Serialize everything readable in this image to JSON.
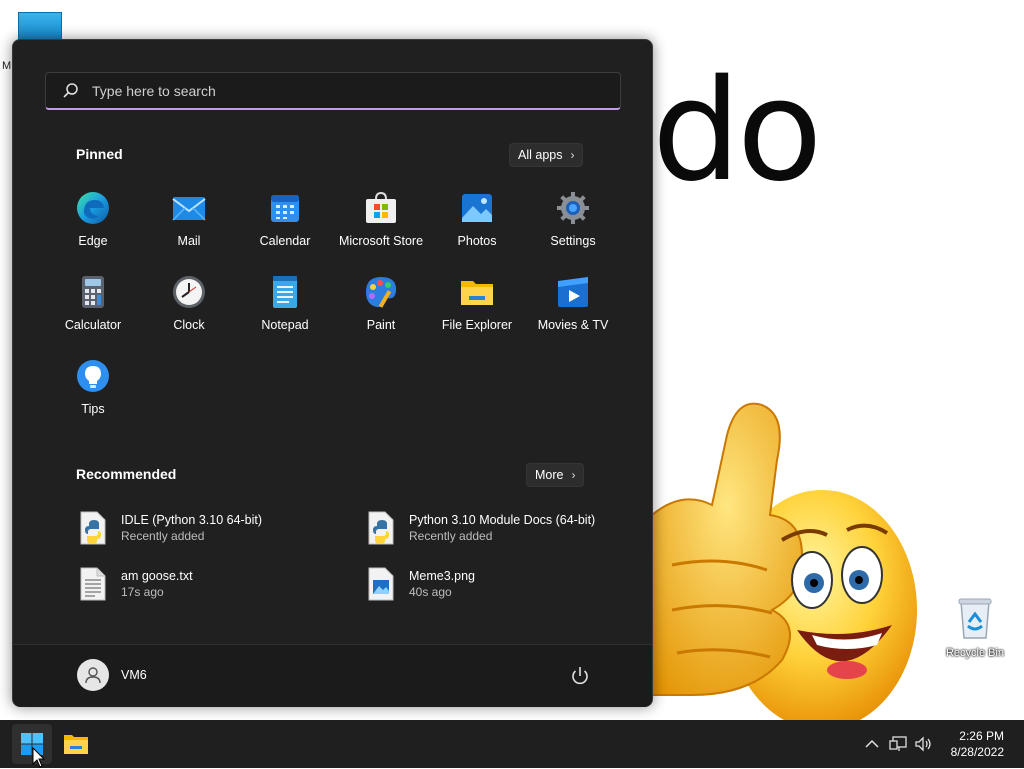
{
  "desktop": {
    "wallpaper_text": "do",
    "top_icon_label": "M",
    "recycle_bin_label": "Recycle Bin"
  },
  "start_menu": {
    "search_placeholder": "Type here to search",
    "pinned_title": "Pinned",
    "all_apps_label": "All apps",
    "pinned_apps": [
      {
        "label": "Edge",
        "icon": "edge-icon"
      },
      {
        "label": "Mail",
        "icon": "mail-icon"
      },
      {
        "label": "Calendar",
        "icon": "calendar-icon"
      },
      {
        "label": "Microsoft Store",
        "icon": "store-icon"
      },
      {
        "label": "Photos",
        "icon": "photos-icon"
      },
      {
        "label": "Settings",
        "icon": "settings-icon"
      },
      {
        "label": "Calculator",
        "icon": "calculator-icon"
      },
      {
        "label": "Clock",
        "icon": "clock-icon"
      },
      {
        "label": "Notepad",
        "icon": "notepad-icon"
      },
      {
        "label": "Paint",
        "icon": "paint-icon"
      },
      {
        "label": "File Explorer",
        "icon": "folder-icon"
      },
      {
        "label": "Movies & TV",
        "icon": "movies-icon"
      },
      {
        "label": "Tips",
        "icon": "tips-icon"
      }
    ],
    "recommended_title": "Recommended",
    "more_label": "More",
    "recommended": [
      {
        "name": "IDLE (Python 3.10 64-bit)",
        "sub": "Recently added",
        "icon": "python-file-icon"
      },
      {
        "name": "Python 3.10 Module Docs (64-bit)",
        "sub": "Recently added",
        "icon": "python-file-icon"
      },
      {
        "name": "am goose.txt",
        "sub": "17s ago",
        "icon": "text-file-icon"
      },
      {
        "name": "Meme3.png",
        "sub": "40s ago",
        "icon": "image-file-icon"
      }
    ],
    "user_name": "VM6"
  },
  "taskbar": {
    "time": "2:26 PM",
    "date": "8/28/2022"
  },
  "colors": {
    "start_bg": "#202020",
    "taskbar_bg": "#1f1f1f",
    "search_accent": "#c39be8",
    "windows_blue": "#1d9bf0"
  }
}
